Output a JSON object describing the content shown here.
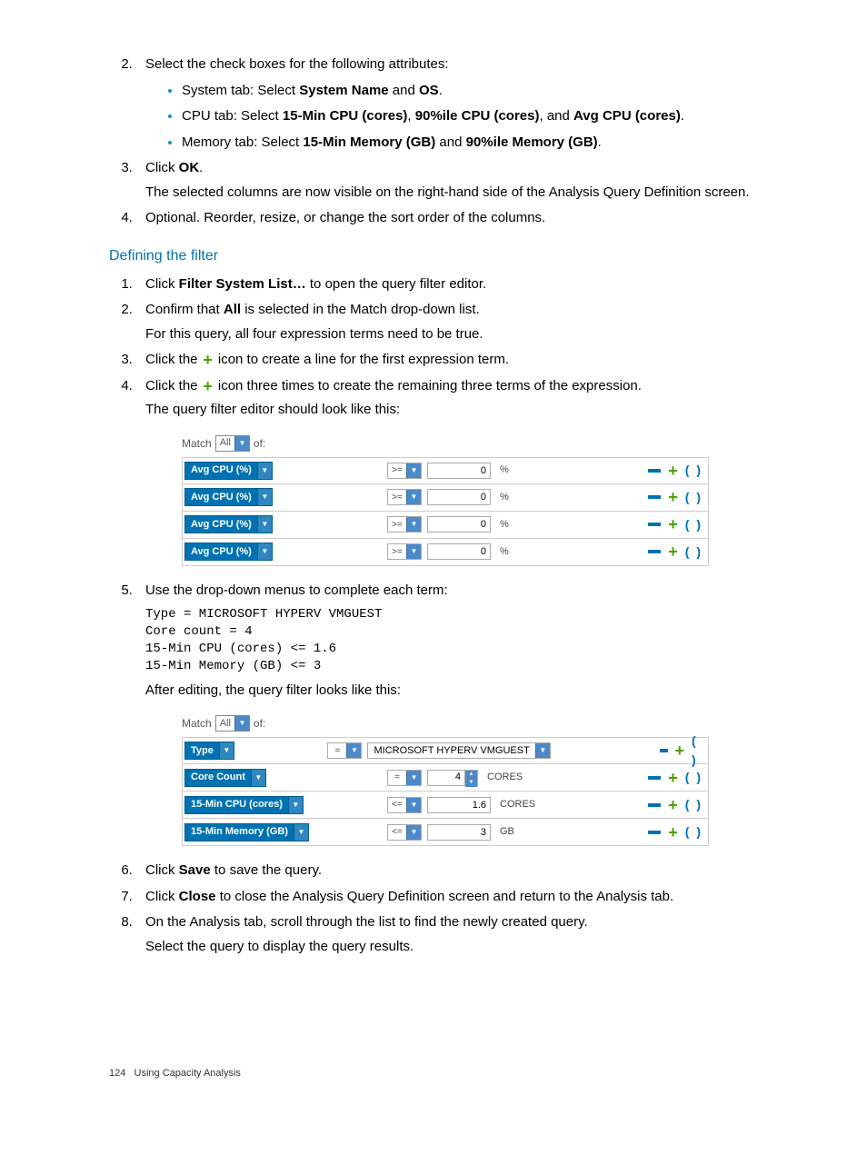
{
  "steps_a": {
    "s2": "Select the check boxes for the following attributes:",
    "bullets": [
      {
        "prefix": "System tab: Select ",
        "b1": "System Name",
        "mid": " and ",
        "b2": "OS",
        "suffix": "."
      },
      {
        "prefix": "CPU tab: Select ",
        "b1": "15-Min CPU (cores)",
        "mid": ", ",
        "b2": "90%ile CPU (cores)",
        "mid2": ", and ",
        "b3": "Avg CPU (cores)",
        "suffix": "."
      },
      {
        "prefix": "Memory tab: Select ",
        "b1": "15-Min Memory (GB)",
        "mid": " and ",
        "b2": "90%ile Memory (GB)",
        "suffix": "."
      }
    ],
    "s3_pre": "Click ",
    "s3_b": "OK",
    "s3_post": ".",
    "s3_para": "The selected columns are now visible on the right-hand side of the Analysis Query Definition screen.",
    "s4": "Optional. Reorder, resize, or change the sort order of the columns."
  },
  "section_title": "Defining the filter",
  "steps_b": {
    "s1_pre": "Click ",
    "s1_b": "Filter System List…",
    "s1_post": " to open the query filter editor.",
    "s2_pre": "Confirm that ",
    "s2_b": "All",
    "s2_post": " is selected in the Match drop-down list.",
    "s2_para": "For this query, all four expression terms need to be true.",
    "s3_pre": "Click the ",
    "s3_post": " icon to create a line for the first expression term.",
    "s4_pre": "Click the ",
    "s4_post": " icon three times to create the remaining three terms of the expression.",
    "s4_para": "The query filter editor should look like this:"
  },
  "filter1": {
    "match_label": "Match",
    "match_value": "All",
    "match_suffix": "of:",
    "rows": [
      {
        "attr": "Avg CPU (%)",
        "op": ">=",
        "val": "0",
        "unit": "%"
      },
      {
        "attr": "Avg CPU (%)",
        "op": ">=",
        "val": "0",
        "unit": "%"
      },
      {
        "attr": "Avg CPU (%)",
        "op": ">=",
        "val": "0",
        "unit": "%"
      },
      {
        "attr": "Avg CPU (%)",
        "op": ">=",
        "val": "0",
        "unit": "%"
      }
    ]
  },
  "steps_c": {
    "s5": "Use the drop-down menus to complete each term:",
    "code": "Type = MICROSOFT HYPERV VMGUEST\nCore count = 4\n15-Min CPU (cores) <= 1.6\n15-Min Memory (GB) <= 3",
    "s5_para": "After editing, the query filter looks like this:"
  },
  "filter2": {
    "match_label": "Match",
    "match_value": "All",
    "match_suffix": "of:",
    "rows": [
      {
        "attr": "Type",
        "op": "=",
        "valselect": "MICROSOFT HYPERV VMGUEST",
        "unit": ""
      },
      {
        "attr": "Core Count",
        "op": "=",
        "stepper": "4",
        "unit": "CORES"
      },
      {
        "attr": "15-Min CPU (cores)",
        "op": "<=",
        "val": "1.6",
        "unit": "CORES"
      },
      {
        "attr": "15-Min Memory (GB)",
        "op": "<=",
        "val": "3",
        "unit": "GB"
      }
    ]
  },
  "steps_d": {
    "s6_pre": "Click ",
    "s6_b": "Save",
    "s6_post": " to save the query.",
    "s7_pre": "Click ",
    "s7_b": "Close",
    "s7_post": " to close the Analysis Query Definition screen and return to the Analysis tab.",
    "s8": "On the Analysis tab, scroll through the list to find the newly created query.",
    "s8_para": "Select the query to display the query results."
  },
  "footer": {
    "page": "124",
    "title": "Using Capacity Analysis"
  }
}
